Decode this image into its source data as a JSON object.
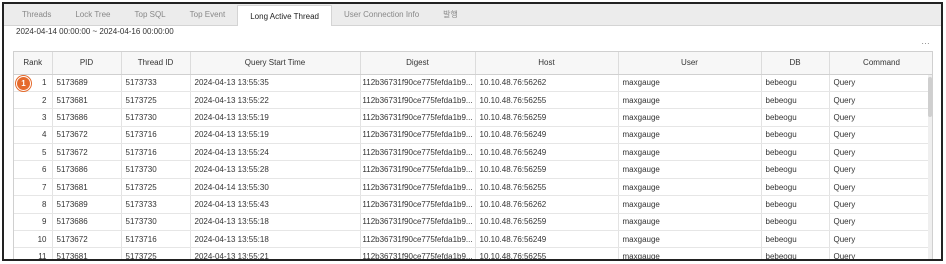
{
  "tabs": [
    {
      "label": "Threads"
    },
    {
      "label": "Lock Tree"
    },
    {
      "label": "Top SQL"
    },
    {
      "label": "Top Event"
    },
    {
      "label": "Long Active Thread"
    },
    {
      "label": "User Connection Info"
    },
    {
      "label": "발행"
    }
  ],
  "active_tab": "Long Active Thread",
  "date_range": "2024-04-14 00:00:00 ~ 2024-04-16 00:00:00",
  "more_icon": "…",
  "marker_label": "1",
  "columns": [
    "Rank",
    "PID",
    "Thread ID",
    "Query Start Time",
    "Digest",
    "Host",
    "User",
    "DB",
    "Command"
  ],
  "rows": [
    {
      "rank": "1",
      "pid": "5173689",
      "thread_id": "5173733",
      "start": "2024-04-13 13:55:35",
      "digest": "112b36731f90ce775fefda1b9...",
      "host": "10.10.48.76:56262",
      "user": "maxgauge",
      "db": "bebeogu",
      "command": "Query"
    },
    {
      "rank": "2",
      "pid": "5173681",
      "thread_id": "5173725",
      "start": "2024-04-13 13:55:22",
      "digest": "112b36731f90ce775fefda1b9...",
      "host": "10.10.48.76:56255",
      "user": "maxgauge",
      "db": "bebeogu",
      "command": "Query"
    },
    {
      "rank": "3",
      "pid": "5173686",
      "thread_id": "5173730",
      "start": "2024-04-13 13:55:19",
      "digest": "112b36731f90ce775fefda1b9...",
      "host": "10.10.48.76:56259",
      "user": "maxgauge",
      "db": "bebeogu",
      "command": "Query"
    },
    {
      "rank": "4",
      "pid": "5173672",
      "thread_id": "5173716",
      "start": "2024-04-13 13:55:19",
      "digest": "112b36731f90ce775fefda1b9...",
      "host": "10.10.48.76:56249",
      "user": "maxgauge",
      "db": "bebeogu",
      "command": "Query"
    },
    {
      "rank": "5",
      "pid": "5173672",
      "thread_id": "5173716",
      "start": "2024-04-13 13:55:24",
      "digest": "112b36731f90ce775fefda1b9...",
      "host": "10.10.48.76:56249",
      "user": "maxgauge",
      "db": "bebeogu",
      "command": "Query"
    },
    {
      "rank": "6",
      "pid": "5173686",
      "thread_id": "5173730",
      "start": "2024-04-13 13:55:28",
      "digest": "112b36731f90ce775fefda1b9...",
      "host": "10.10.48.76:56259",
      "user": "maxgauge",
      "db": "bebeogu",
      "command": "Query"
    },
    {
      "rank": "7",
      "pid": "5173681",
      "thread_id": "5173725",
      "start": "2024-04-14 13:55:30",
      "digest": "112b36731f90ce775fefda1b9...",
      "host": "10.10.48.76:56255",
      "user": "maxgauge",
      "db": "bebeogu",
      "command": "Query"
    },
    {
      "rank": "8",
      "pid": "5173689",
      "thread_id": "5173733",
      "start": "2024-04-13 13:55:43",
      "digest": "112b36731f90ce775fefda1b9...",
      "host": "10.10.48.76:56262",
      "user": "maxgauge",
      "db": "bebeogu",
      "command": "Query"
    },
    {
      "rank": "9",
      "pid": "5173686",
      "thread_id": "5173730",
      "start": "2024-04-13 13:55:18",
      "digest": "112b36731f90ce775fefda1b9...",
      "host": "10.10.48.76:56259",
      "user": "maxgauge",
      "db": "bebeogu",
      "command": "Query"
    },
    {
      "rank": "10",
      "pid": "5173672",
      "thread_id": "5173716",
      "start": "2024-04-13 13:55:18",
      "digest": "112b36731f90ce775fefda1b9...",
      "host": "10.10.48.76:56249",
      "user": "maxgauge",
      "db": "bebeogu",
      "command": "Query"
    },
    {
      "rank": "11",
      "pid": "5173681",
      "thread_id": "5173725",
      "start": "2024-04-13 13:55:21",
      "digest": "112b36731f90ce775fefda1b9...",
      "host": "10.10.48.76:56255",
      "user": "maxgauge",
      "db": "bebeogu",
      "command": "Query"
    }
  ],
  "colors": {
    "marker": "#e56a2c",
    "tab_bar": "#ececec"
  }
}
